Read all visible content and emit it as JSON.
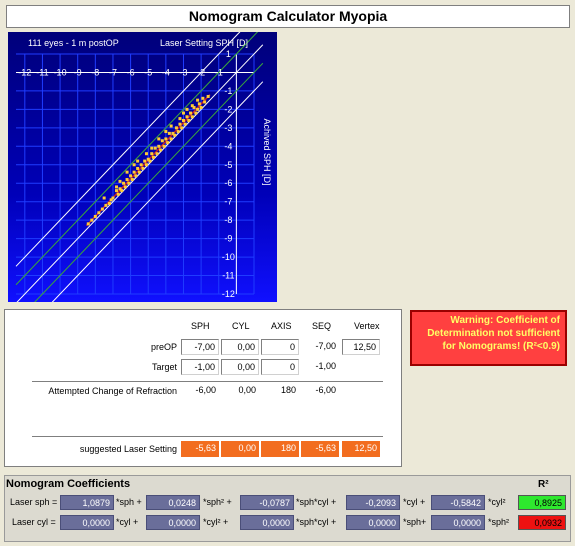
{
  "app_title": "Nomogram Calculator Myopia",
  "chart": {
    "info_label": "111 eyes - 1 m postOP",
    "x_axis_title": "Laser Setting SPH [D]",
    "y_axis_title": "Achived SPH [D]",
    "x_ticks": [
      "-12",
      "-11",
      "-10",
      "-9",
      "-8",
      "-7",
      "-6",
      "-5",
      "-4",
      "-3",
      "-2",
      "-1"
    ],
    "y_ticks": [
      "1",
      "-1",
      "-2",
      "-3",
      "-4",
      "-5",
      "-6",
      "-7",
      "-8",
      "-9",
      "-10",
      "-11",
      "-12"
    ],
    "colors": {
      "background": "#00008b",
      "grid": "#1f3cff",
      "diag": "#ffffff",
      "band": "#3aa83a",
      "points": "#ffcc33",
      "regression": "#cc2222"
    }
  },
  "chart_data": {
    "type": "scatter",
    "xlabel": "Laser Setting SPH [D]",
    "ylabel": "Achived SPH [D]",
    "xlim": [
      -12.5,
      1
    ],
    "ylim": [
      -12,
      1
    ],
    "grid": true,
    "series": [
      {
        "points": [
          [
            -1.6,
            -1.3
          ],
          [
            -1.8,
            -1.6
          ],
          [
            -1.9,
            -1.4
          ],
          [
            -2.0,
            -1.9
          ],
          [
            -2.1,
            -1.7
          ],
          [
            -2.2,
            -2.0
          ],
          [
            -2.3,
            -2.2
          ],
          [
            -2.4,
            -1.9
          ],
          [
            -2.5,
            -2.4
          ],
          [
            -2.6,
            -2.2
          ],
          [
            -2.7,
            -2.6
          ],
          [
            -2.8,
            -2.4
          ],
          [
            -2.9,
            -2.8
          ],
          [
            -3.0,
            -2.6
          ],
          [
            -3.1,
            -3.0
          ],
          [
            -3.2,
            -2.8
          ],
          [
            -3.3,
            -3.2
          ],
          [
            -3.4,
            -3.0
          ],
          [
            -3.5,
            -3.4
          ],
          [
            -3.6,
            -3.3
          ],
          [
            -3.7,
            -3.6
          ],
          [
            -3.8,
            -3.3
          ],
          [
            -3.9,
            -3.8
          ],
          [
            -4.0,
            -3.6
          ],
          [
            -4.1,
            -4.0
          ],
          [
            -4.2,
            -3.7
          ],
          [
            -4.3,
            -4.2
          ],
          [
            -4.4,
            -4.0
          ],
          [
            -4.5,
            -4.4
          ],
          [
            -4.6,
            -4.1
          ],
          [
            -4.7,
            -4.6
          ],
          [
            -4.8,
            -4.4
          ],
          [
            -4.9,
            -4.8
          ],
          [
            -5.0,
            -4.7
          ],
          [
            -5.1,
            -5.0
          ],
          [
            -5.2,
            -4.8
          ],
          [
            -5.3,
            -5.2
          ],
          [
            -5.4,
            -5.0
          ],
          [
            -5.5,
            -5.4
          ],
          [
            -5.6,
            -5.2
          ],
          [
            -5.7,
            -5.6
          ],
          [
            -5.8,
            -5.4
          ],
          [
            -5.9,
            -5.8
          ],
          [
            -6.0,
            -5.6
          ],
          [
            -6.1,
            -6.0
          ],
          [
            -6.2,
            -5.8
          ],
          [
            -6.3,
            -6.2
          ],
          [
            -6.4,
            -6.0
          ],
          [
            -6.5,
            -6.4
          ],
          [
            -6.6,
            -6.3
          ],
          [
            -6.7,
            -6.6
          ],
          [
            -6.8,
            -6.4
          ],
          [
            -7.0,
            -6.8
          ],
          [
            -7.1,
            -6.9
          ],
          [
            -7.2,
            -7.1
          ],
          [
            -7.4,
            -7.2
          ],
          [
            -7.6,
            -7.4
          ],
          [
            -7.8,
            -7.6
          ],
          [
            -8.0,
            -7.8
          ],
          [
            -8.2,
            -8.0
          ],
          [
            -8.4,
            -8.2
          ],
          [
            -6.2,
            -5.4
          ],
          [
            -5.6,
            -4.8
          ],
          [
            -4.4,
            -3.6
          ],
          [
            -3.2,
            -2.5
          ],
          [
            -2.5,
            -1.8
          ],
          [
            -6.8,
            -6.2
          ],
          [
            -7.5,
            -6.8
          ],
          [
            -5.1,
            -4.4
          ],
          [
            -3.7,
            -2.9
          ],
          [
            -2.2,
            -1.5
          ],
          [
            -4.0,
            -3.2
          ],
          [
            -3.0,
            -2.2
          ],
          [
            -2.8,
            -2.0
          ],
          [
            -5.8,
            -5.0
          ],
          [
            -6.6,
            -5.9
          ],
          [
            -4.8,
            -4.1
          ]
        ]
      }
    ]
  },
  "warning": "Warning: Coefficient of Determination not sufficient for Nomograms! (R²<0.9)",
  "table": {
    "headers": {
      "sph": "SPH",
      "cyl": "CYL",
      "axis": "AXIS",
      "seq": "SEQ",
      "vertex": "Vertex"
    },
    "preop": {
      "label": "preOP",
      "sph": "-7,00",
      "cyl": "0,00",
      "axis": "0",
      "seq": "-7,00",
      "vertex": "12,50"
    },
    "target": {
      "label": "Target",
      "sph": "-1,00",
      "cyl": "0,00",
      "axis": "0",
      "seq": "-1,00"
    },
    "attempted": {
      "label": "Attempted Change of Refraction",
      "sph": "-6,00",
      "cyl": "0,00",
      "axis": "180",
      "seq": "-6,00"
    },
    "suggested": {
      "label": "suggested Laser Setting",
      "sph": "-5,63",
      "cyl": "0,00",
      "axis": "180",
      "seq": "-5,63",
      "vertex": "12,50"
    }
  },
  "coefficients": {
    "title": "Nomogram Coefficients",
    "r2_label": "R²",
    "laser_sph": {
      "label": "Laser sph =",
      "values": [
        "1,0879",
        "0,0248",
        "-0,0787",
        "-0,2093",
        "-0,5842"
      ],
      "terms": [
        "*sph +",
        "*sph² +",
        "*sph*cyl +",
        "*cyl +",
        "*cyl²"
      ],
      "r2": "0,8925",
      "r2_color": "#2ee82e"
    },
    "laser_cyl": {
      "label": "Laser cyl =",
      "values": [
        "0,0000",
        "0,0000",
        "0,0000",
        "0,0000",
        "0,0000"
      ],
      "terms": [
        "*cyl +",
        "*cyl² +",
        "*sph*cyl +",
        "*sph+",
        "*sph²"
      ],
      "r2": "0,0932",
      "r2_color": "#ee1111"
    }
  }
}
